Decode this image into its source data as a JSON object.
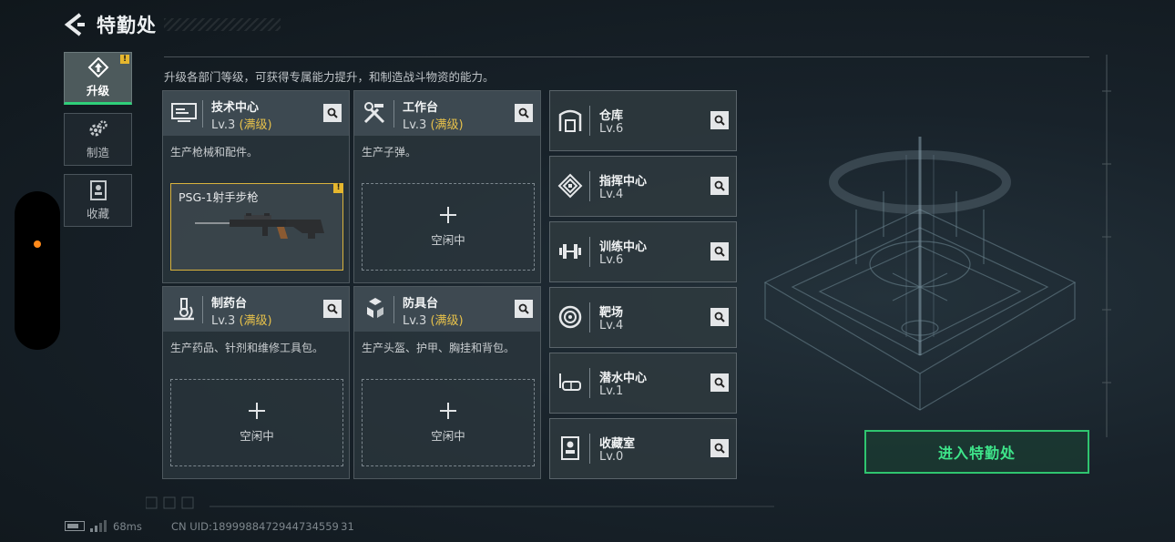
{
  "header": {
    "title": "特勤处",
    "subtitle": "升级各部门等级，可获得专属能力提升，和制造战斗物资的能力。"
  },
  "nav": [
    {
      "label": "升级",
      "icon": "upgrade-icon",
      "active": true,
      "badge": "!"
    },
    {
      "label": "制造",
      "icon": "gears-icon",
      "active": false
    },
    {
      "label": "收藏",
      "icon": "collection-icon",
      "active": false
    }
  ],
  "cards": [
    {
      "name": "技术中心",
      "level": "Lv.3",
      "maxed": "(满级)",
      "desc": "生产枪械和配件。",
      "icon": "tech-center-icon",
      "slot": {
        "state": "busy",
        "item_name": "PSG-1射手步枪",
        "badge": "!"
      }
    },
    {
      "name": "工作台",
      "level": "Lv.3",
      "maxed": "(满级)",
      "desc": "生产子弹。",
      "icon": "workbench-tools-icon",
      "slot": {
        "state": "idle",
        "label": "空闲中"
      }
    },
    {
      "name": "制药台",
      "level": "Lv.3",
      "maxed": "(满级)",
      "desc": "生产药品、针剂和维修工具包。",
      "icon": "microscope-icon",
      "slot": {
        "state": "idle",
        "label": "空闲中"
      }
    },
    {
      "name": "防具台",
      "level": "Lv.3",
      "maxed": "(满级)",
      "desc": "生产头盔、护甲、胸挂和背包。",
      "icon": "armor-boxes-icon",
      "slot": {
        "state": "idle",
        "label": "空闲中"
      }
    }
  ],
  "facilities": [
    {
      "name": "仓库",
      "level": "Lv.6",
      "icon": "warehouse-icon"
    },
    {
      "name": "指挥中心",
      "level": "Lv.4",
      "icon": "command-center-icon"
    },
    {
      "name": "训练中心",
      "level": "Lv.6",
      "icon": "dumbbell-icon"
    },
    {
      "name": "靶场",
      "level": "Lv.4",
      "icon": "target-icon"
    },
    {
      "name": "潜水中心",
      "level": "Lv.1",
      "icon": "diving-mask-icon"
    },
    {
      "name": "收藏室",
      "level": "Lv.0",
      "icon": "collection-room-icon"
    }
  ],
  "enter_button": "进入特勤处",
  "footer": {
    "ping": "68ms",
    "uid": "CN UID:1899988472944734559 31"
  },
  "colors": {
    "accent_green": "#2fc56f",
    "maxed_gold": "#e7c14a",
    "badge_yellow": "#e6b72e",
    "background": "#18222a"
  }
}
